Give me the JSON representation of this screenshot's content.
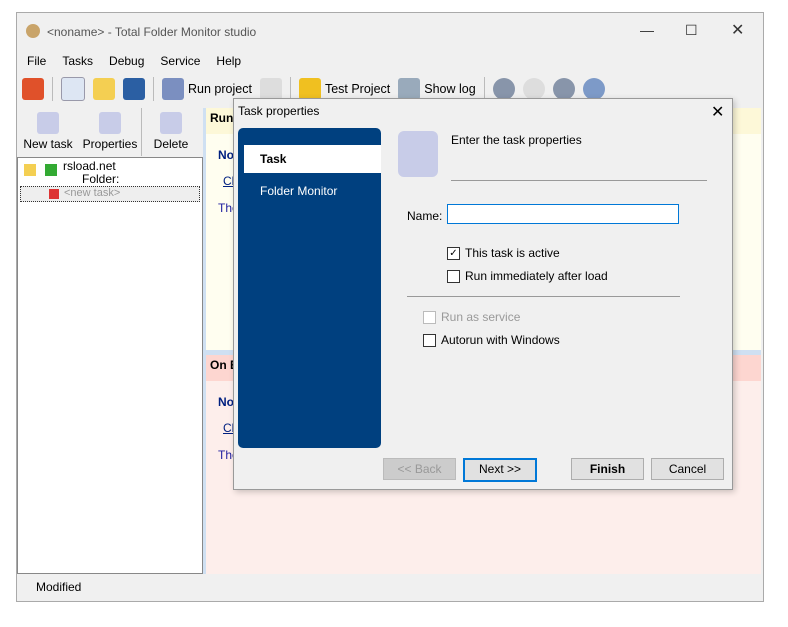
{
  "window": {
    "title": "<noname> - Total Folder Monitor studio"
  },
  "menu": [
    "File",
    "Tasks",
    "Debug",
    "Service",
    "Help"
  ],
  "toolbar": {
    "run": "Run project",
    "test": "Test Project",
    "log": "Show log"
  },
  "left_toolbar": {
    "new": "New task",
    "props": "Properties",
    "delete": "Delete"
  },
  "tree": {
    "item1": "rsload.net",
    "item1_sub": "Folder:",
    "item2": "<new task>"
  },
  "right": {
    "run_header": "Run",
    "no1": "No",
    "cl1": "Cl",
    "the1": "The",
    "onb_header": "On E",
    "no2": "No",
    "cl2": "Cl",
    "the2": "The"
  },
  "status": "Modified",
  "dialog": {
    "title": "Task properties",
    "steps": [
      "Task",
      "Folder Monitor"
    ],
    "heading": "Enter the task properties",
    "name_label": "Name:",
    "name_value": "",
    "active": "This task is active",
    "run_immediately": "Run immediately after load",
    "run_as_service": "Run as service",
    "autorun": "Autorun with Windows",
    "back": "<< Back",
    "next": "Next >>",
    "finish": "Finish",
    "cancel": "Cancel"
  }
}
